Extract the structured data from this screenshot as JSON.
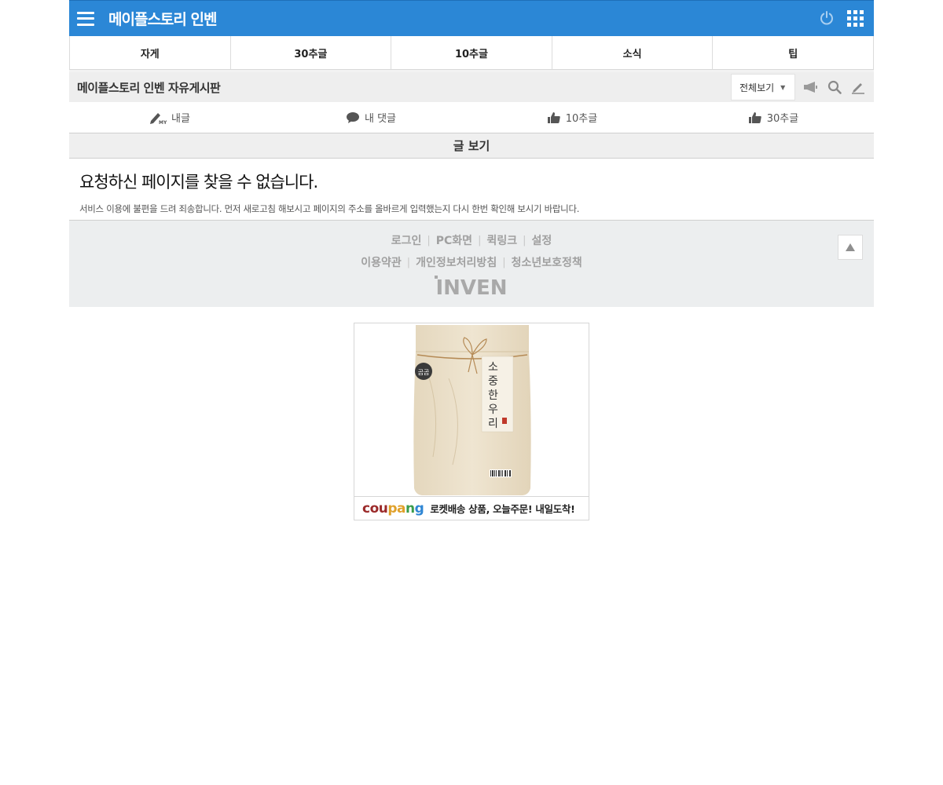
{
  "header": {
    "title": "메이플스토리 인벤"
  },
  "category_tabs": [
    "자게",
    "30추글",
    "10추글",
    "소식",
    "팁"
  ],
  "board": {
    "title": "메이플스토리 인벤 자유게시판",
    "view_select": "전체보기"
  },
  "my_bar": {
    "my_posts": "내글",
    "my_comments": "내 댓글",
    "ten_recommended": "10추글",
    "thirty_recommended": "30추글"
  },
  "section": {
    "title": "글 보기"
  },
  "error": {
    "title": "요청하신 페이지를 찾을 수 없습니다.",
    "description": "서비스 이용에 불편을 드려 죄송합니다. 먼저 새로고침 해보시고 페이지의 주소를 올바르게 입력했는지 다시 한번 확인해 보시기 바랍니다."
  },
  "footer": {
    "row1": [
      "로그인",
      "PC화면",
      "퀵링크",
      "설정"
    ],
    "row2": [
      "이용약관",
      "개인정보처리방침",
      "청소년보호정책"
    ],
    "logo": "INVEN"
  },
  "ad": {
    "brand": "coupang",
    "text": "로켓배송 상품, 오늘주문! 내일도착!",
    "product_label": "소중한 우리쌀",
    "badge": "곰곰"
  },
  "colors": {
    "header_bg": "#2b87d6",
    "footer_bg": "#eceeef"
  }
}
